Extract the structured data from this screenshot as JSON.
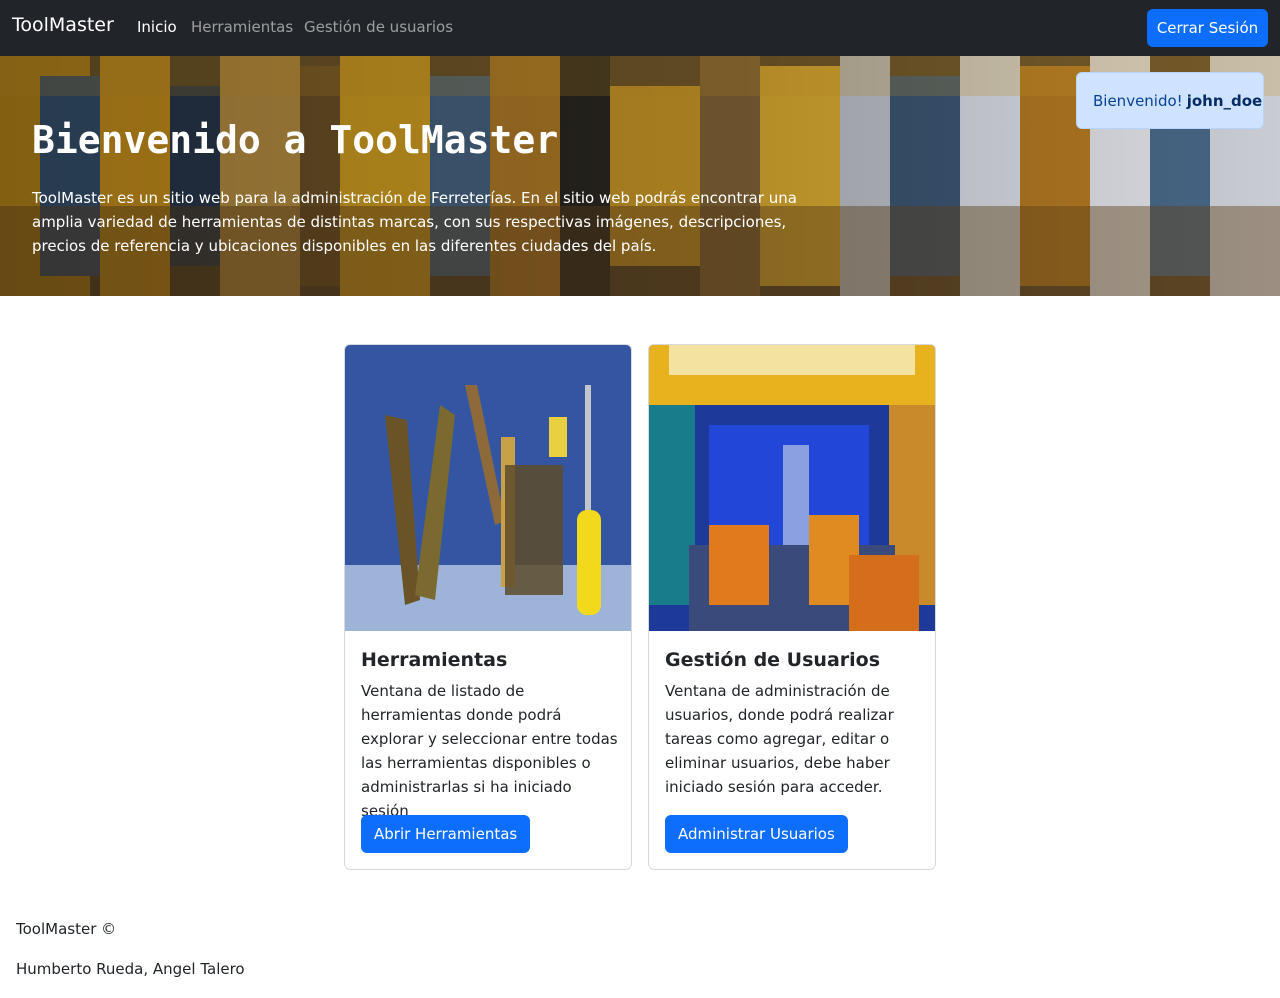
{
  "navbar": {
    "brand": "ToolMaster",
    "links": [
      {
        "label": "Inicio",
        "active": true
      },
      {
        "label": "Herramientas",
        "active": false
      },
      {
        "label": "Gestión de usuarios",
        "active": false
      }
    ],
    "logout_label": "Cerrar Sesión"
  },
  "toast": {
    "prefix": "Bienvenido!",
    "username": "john_doe"
  },
  "hero": {
    "title": "Bienvenido a ToolMaster",
    "text": "ToolMaster es un sitio web para la administración de Ferreterías. En el sitio web podrás encontrar una amplia variedad de herramientas de distintas marcas, con sus respectivas imágenes, descripciones, precios de referencia y ubicaciones disponibles en las diferentes ciudades del país."
  },
  "cards": [
    {
      "title": "Herramientas",
      "text": "Ventana de listado de herramientas donde podrá explorar y seleccionar entre todas las herramientas disponibles o administrarlas si ha iniciado sesión",
      "button": "Abrir Herramientas"
    },
    {
      "title": "Gestión de Usuarios",
      "text": "Ventana de administración de usuarios, donde podrá realizar tareas como agregar, editar o eliminar usuarios, debe haber iniciado sesión para acceder.",
      "button": "Administrar Usuarios"
    }
  ],
  "footer": {
    "copyright": "ToolMaster ©",
    "authors": "Humberto Rueda, Angel Talero"
  },
  "colors": {
    "navbar_bg": "#212529",
    "primary": "#0d6efd",
    "toast_bg": "#cfe2ff",
    "toast_text": "#084298"
  }
}
